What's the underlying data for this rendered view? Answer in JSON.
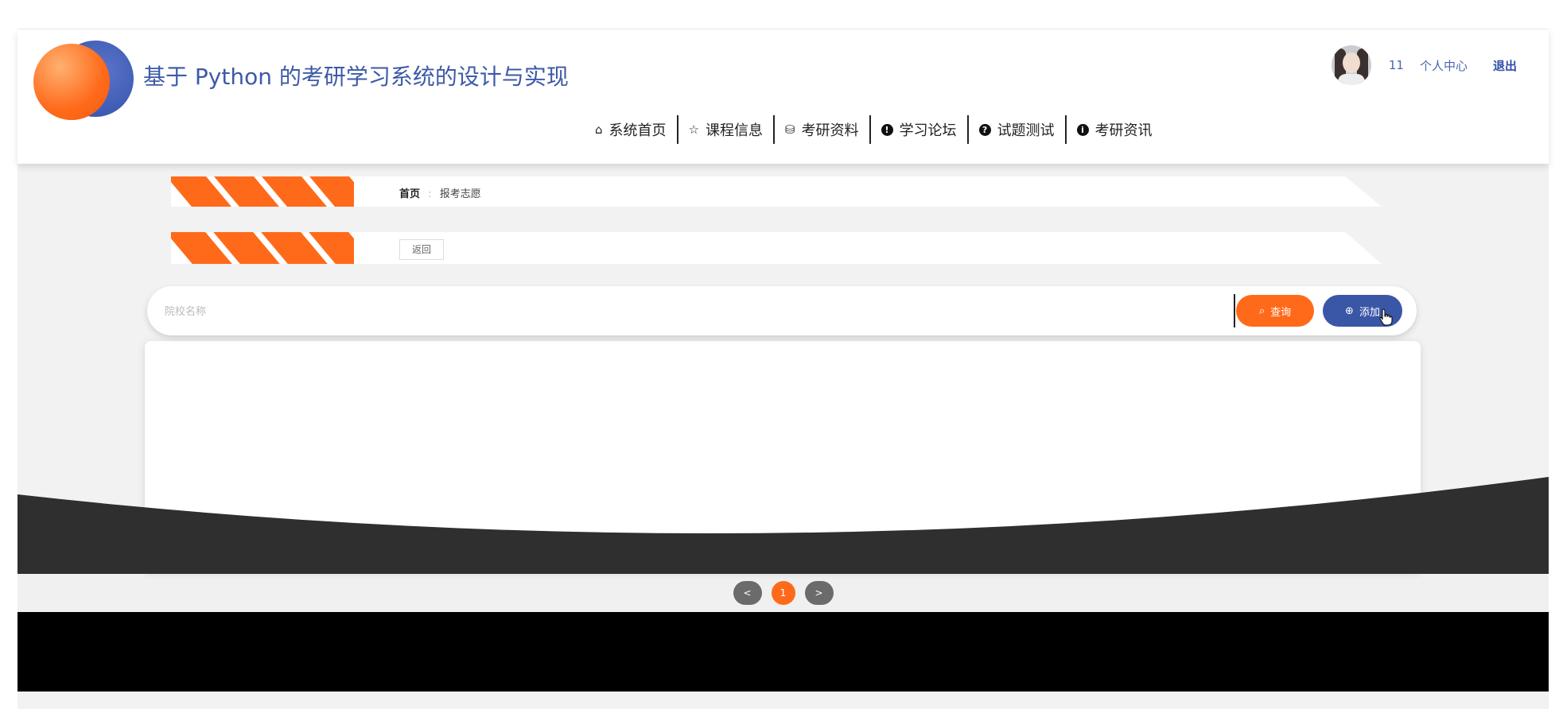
{
  "header": {
    "site_title": "基于 Python 的考研学习系统的设计与实现",
    "user": {
      "name": "11",
      "center_label": "个人中心",
      "logout_label": "退出"
    }
  },
  "nav": {
    "items": [
      {
        "label": "系统首页",
        "icon": "home-icon"
      },
      {
        "label": "课程信息",
        "icon": "star-icon"
      },
      {
        "label": "考研资料",
        "icon": "bag-icon"
      },
      {
        "label": "学习论坛",
        "icon": "exclamation-circle-icon"
      },
      {
        "label": "试题测试",
        "icon": "question-circle-icon"
      },
      {
        "label": "考研资讯",
        "icon": "info-circle-icon"
      }
    ]
  },
  "breadcrumb": {
    "home": "首页",
    "separator": ":",
    "current": "报考志愿"
  },
  "back_label": "返回",
  "search": {
    "placeholder": "院校名称",
    "value": "",
    "query_label": "查询",
    "add_label": "添加"
  },
  "pagination": {
    "prev": "<",
    "current": "1",
    "next": ">"
  },
  "colors": {
    "accent": "#ff6a1a",
    "primary": "#3a56a6",
    "dark": "#2f2f2f"
  }
}
